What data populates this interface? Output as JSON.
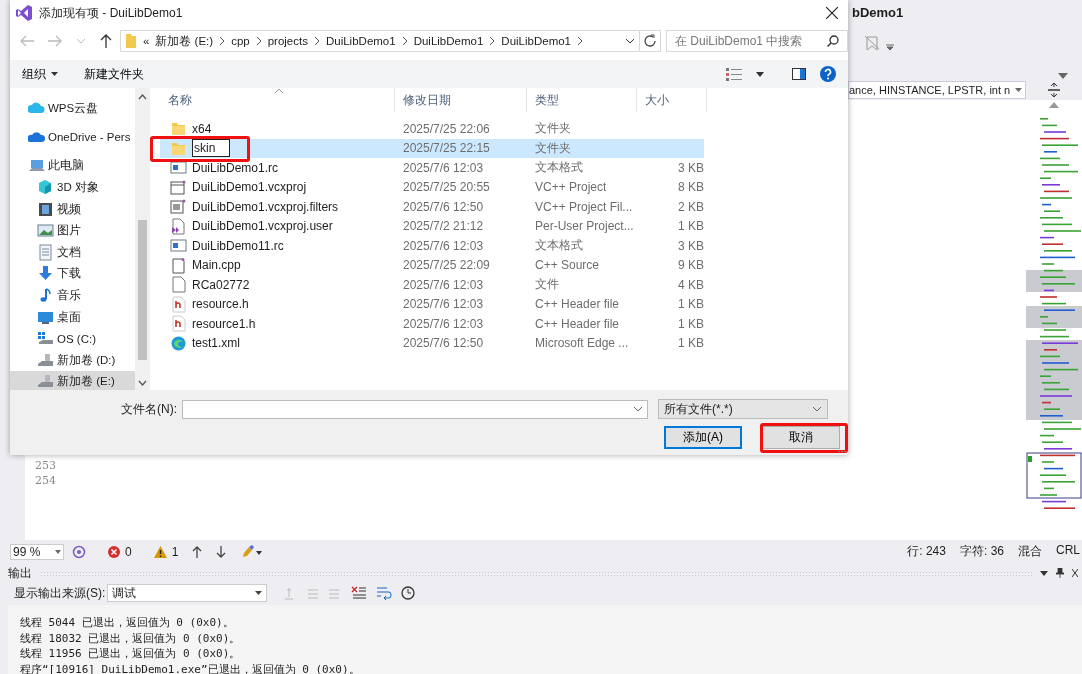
{
  "vs": {
    "title_fragment": "bDemo1",
    "function_dropdown": "ance, HINSTANCE, LPSTR, int n",
    "line_numbers": [
      "253",
      "254"
    ],
    "status": {
      "zoom": "99 %",
      "errors": "0",
      "warnings": "1",
      "line": "行: 243",
      "column": "字符: 36",
      "mode": "混合",
      "eol": "CRL"
    },
    "output": {
      "title": "输出",
      "source_label": "显示输出来源(S):",
      "source": "调试",
      "lines": [
        "线程 5044 已退出，返回值为 0 (0x0)。",
        "线程 18032 已退出，返回值为 0 (0x0)。",
        "线程 11956 已退出，返回值为 0 (0x0)。",
        "程序“[10916] DuiLibDemo1.exe”已退出，返回值为 0 (0x0)。"
      ]
    }
  },
  "dialog": {
    "title": "添加现有项 - DuiLibDemo1",
    "breadcrumb": [
      "«",
      "新加卷 (E:)",
      "cpp",
      "projects",
      "DuiLibDemo1",
      "DuiLibDemo1",
      "DuiLibDemo1"
    ],
    "search": {
      "placeholder": "在 DuiLibDemo1 中搜索"
    },
    "toolbar": [
      {
        "label": "组织",
        "kind": "menu"
      },
      {
        "label": "新建文件夹",
        "kind": "plain"
      }
    ],
    "nav_items": [
      {
        "label": "WPS云盘",
        "kind": "cloud",
        "selected": false
      },
      {
        "label": "OneDrive - Pers",
        "kind": "onedrive",
        "selected": false
      },
      {
        "label": "此电脑",
        "kind": "pc",
        "selected": false,
        "children": [
          {
            "label": "3D 对象",
            "kind": "cube",
            "selected": false
          },
          {
            "label": "视频",
            "kind": "video",
            "selected": false
          },
          {
            "label": "图片",
            "kind": "picture",
            "selected": false
          },
          {
            "label": "文档",
            "kind": "document",
            "selected": false
          },
          {
            "label": "下载",
            "kind": "download",
            "selected": false
          },
          {
            "label": "音乐",
            "kind": "music",
            "selected": false
          },
          {
            "label": "桌面",
            "kind": "desktop",
            "selected": false
          },
          {
            "label": "OS (C:)",
            "kind": "osdrive",
            "selected": false
          },
          {
            "label": "新加卷 (D:)",
            "kind": "drive",
            "selected": false
          },
          {
            "label": "新加卷 (E:)",
            "kind": "drive",
            "selected": true
          }
        ]
      }
    ],
    "columns": [
      "名称",
      "修改日期",
      "类型",
      "大小"
    ],
    "files": [
      {
        "name": "x64",
        "modified": "2025/7/25 22:06",
        "type": "文件夹",
        "kind": "folder",
        "selected": false,
        "renaming": false,
        "highlighted": false
      },
      {
        "name": "skin",
        "modified": "2025/7/25 22:15",
        "type": "文件夹",
        "kind": "folder",
        "selected": true,
        "renaming": true,
        "highlighted": true
      },
      {
        "name": "DuiLibDemo1.rc",
        "modified": "2025/7/6 12:03",
        "type": "文本格式",
        "size": "3 KB",
        "kind": "rc",
        "selected": false,
        "renaming": false,
        "highlighted": false
      },
      {
        "name": "DuiLibDemo1.vcxproj",
        "modified": "2025/7/25 20:55",
        "type": "VC++ Project",
        "size": "8 KB",
        "kind": "project",
        "selected": false,
        "renaming": false,
        "highlighted": false
      },
      {
        "name": "DuiLibDemo1.vcxproj.filters",
        "modified": "2025/7/6 12:50",
        "type": "VC++ Project Fil...",
        "size": "2 KB",
        "kind": "filters",
        "selected": false,
        "renaming": false,
        "highlighted": false
      },
      {
        "name": "DuiLibDemo1.vcxproj.user",
        "modified": "2025/7/2 21:12",
        "type": "Per-User Project...",
        "size": "1 KB",
        "kind": "user",
        "selected": false,
        "renaming": false,
        "highlighted": false
      },
      {
        "name": "DuiLibDemo11.rc",
        "modified": "2025/7/6 12:03",
        "type": "文本格式",
        "size": "3 KB",
        "kind": "rc",
        "selected": false,
        "renaming": false,
        "highlighted": false
      },
      {
        "name": "Main.cpp",
        "modified": "2025/7/25 22:09",
        "type": "C++ Source",
        "size": "9 KB",
        "kind": "cpp",
        "selected": false,
        "renaming": false,
        "highlighted": false
      },
      {
        "name": "RCa02772",
        "modified": "2025/7/6 12:03",
        "type": "文件",
        "size": "4 KB",
        "kind": "file",
        "selected": false,
        "renaming": false,
        "highlighted": false
      },
      {
        "name": "resource.h",
        "modified": "2025/7/6 12:03",
        "type": "C++ Header file",
        "size": "1 KB",
        "kind": "header",
        "selected": false,
        "renaming": false,
        "highlighted": false
      },
      {
        "name": "resource1.h",
        "modified": "2025/7/6 12:03",
        "type": "C++ Header file",
        "size": "1 KB",
        "kind": "header",
        "selected": false,
        "renaming": false,
        "highlighted": false
      },
      {
        "name": "test1.xml",
        "modified": "2025/7/6 12:50",
        "type": "Microsoft Edge ...",
        "size": "1 KB",
        "kind": "edge",
        "selected": false,
        "renaming": false,
        "highlighted": false
      }
    ],
    "filename_label": "文件名(N):",
    "filter": "所有文件(*.*)",
    "buttons": [
      {
        "label": "添加(A)",
        "default": true,
        "highlighted": false
      },
      {
        "label": "取消",
        "default": false,
        "highlighted": true
      }
    ]
  }
}
